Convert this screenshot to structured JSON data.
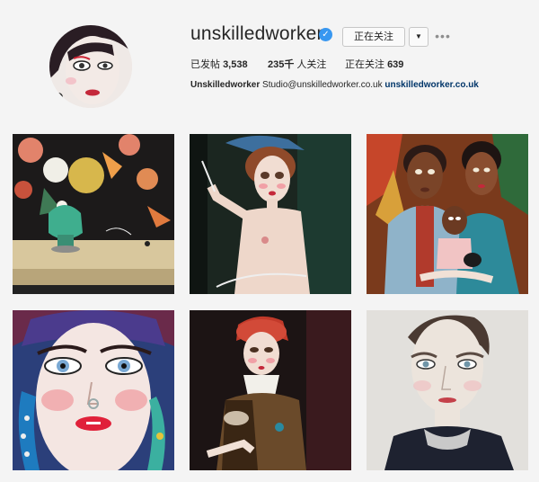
{
  "profile": {
    "username": "unskilledworker",
    "verified_mark": "✓",
    "follow_button_label": "正在关注",
    "dropdown_label": "▼",
    "more_label": "•••",
    "stats": {
      "posts_label": "已发帖",
      "posts_value": "3,538",
      "followers_value": "235千",
      "followers_label": "人关注",
      "following_label": "正在关注",
      "following_value": "639"
    },
    "bio": {
      "name": "Unskilledworker",
      "text": "Studio@unskilledworker.co.uk",
      "link": "unskilledworker.co.uk"
    }
  },
  "icons": {
    "verified": "verified-badge-icon",
    "dropdown": "chevron-down-icon",
    "more": "more-options-icon"
  },
  "colors": {
    "accent": "#3897f0",
    "link": "#003569",
    "background": "#f4f4f4"
  }
}
